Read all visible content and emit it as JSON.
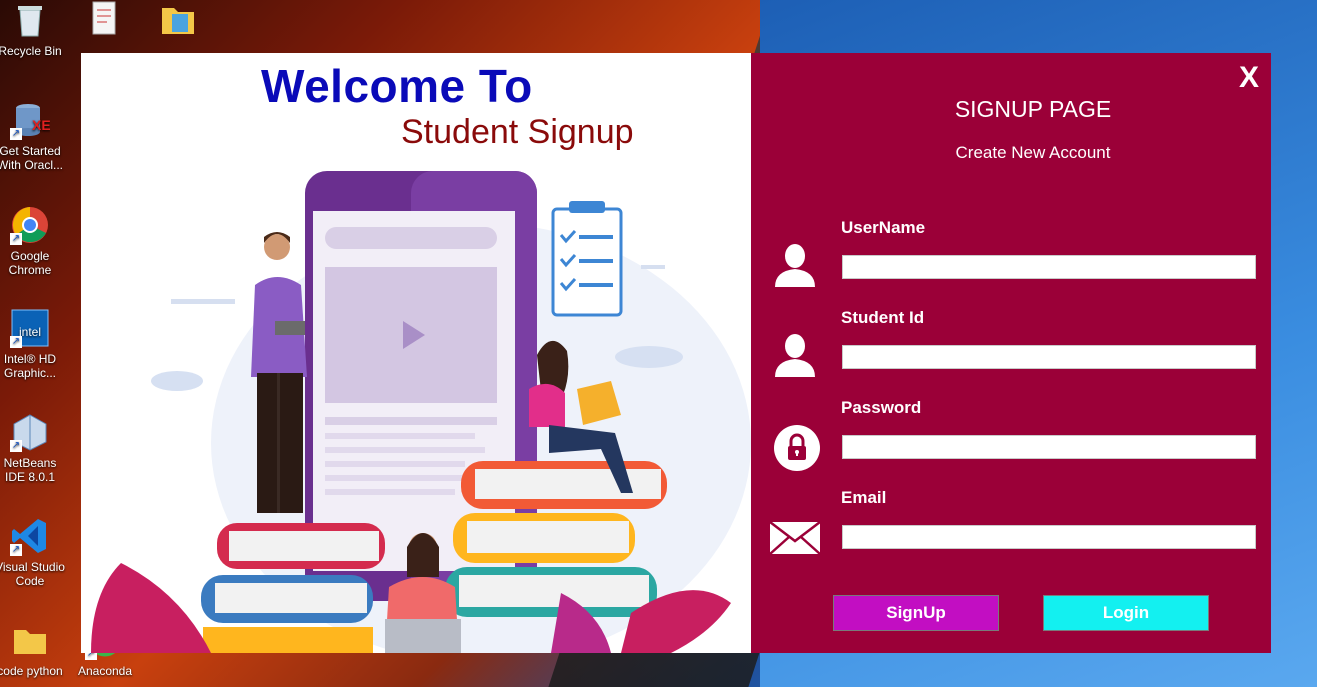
{
  "desktop": {
    "icons": [
      {
        "label": "Recycle Bin",
        "icon": "recycle-bin-icon"
      },
      {
        "label": "Get Started With Oracl...",
        "icon": "oracle-xe-icon"
      },
      {
        "label": "Google Chrome",
        "icon": "chrome-icon"
      },
      {
        "label": "Intel® HD Graphic...",
        "icon": "intel-graphics-icon"
      },
      {
        "label": "NetBeans IDE 8.0.1",
        "icon": "netbeans-icon"
      },
      {
        "label": "Visual Studio Code",
        "icon": "vscode-icon"
      },
      {
        "label": "code python",
        "icon": "folder-icon"
      },
      {
        "label": "Anaconda",
        "icon": "anaconda-icon"
      }
    ]
  },
  "window": {
    "welcome_title": "Welcome To",
    "welcome_subtitle": "Student Signup",
    "close_label": "X",
    "page_title": "SIGNUP PAGE",
    "page_description": "Create New Account",
    "fields": {
      "username": {
        "label": "UserName",
        "value": "",
        "icon": "user-icon"
      },
      "student_id": {
        "label": "Student Id",
        "value": "",
        "icon": "user-icon"
      },
      "password": {
        "label": "Password",
        "value": "",
        "icon": "lock-icon"
      },
      "email": {
        "label": "Email",
        "value": "",
        "icon": "envelope-icon"
      }
    },
    "buttons": {
      "signup": "SignUp",
      "login": "Login"
    },
    "colors": {
      "panel": "#9b0038",
      "signup_button": "#c20ec2",
      "login_button": "#13f0f0",
      "title_blue": "#0a0ab8",
      "subtitle_red": "#8a0a0a"
    }
  }
}
